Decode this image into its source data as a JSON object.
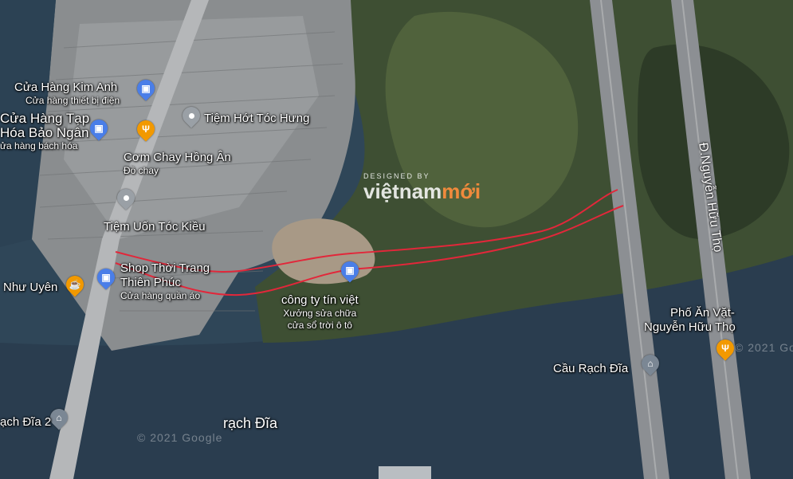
{
  "map": {
    "colors": {
      "water": "#2f4658",
      "river": "#2a3e50",
      "land_dark": "#2d3a2a",
      "land_green": "#4c5e3b",
      "urban": "#8f9295",
      "route": "#e2273a",
      "bridge": "#8c8f93"
    },
    "watermark": {
      "top": "DESIGNED BY",
      "main": "việtnam",
      "accent": "mới"
    },
    "road_labels": {
      "nguyen_huu_tho": "Đ.Nguyễn Hữu Thọ"
    },
    "water_labels": {
      "rach_dia": "rạch Đĩa"
    },
    "copyright": {
      "left": "© 2021 Google",
      "right": "© 2021 Goog"
    },
    "pois": [
      {
        "id": "kim-anh",
        "name": "Cửa Hàng Kim Anh",
        "sub": "Cửa hàng thiết bị điện",
        "icon": "shopping-bag-icon"
      },
      {
        "id": "tap-hoa",
        "name": "Cửa Hàng Tạp Hóa Bảo Ngân",
        "name_line1": "Cửa Hàng Tạp",
        "name_line2": "Hóa Bảo Ngân",
        "sub": "ửa hàng bách hóa",
        "icon": "shopping-bag-icon"
      },
      {
        "id": "toc-hung",
        "name": "Tiệm Hớt Tóc Hưng",
        "sub": "",
        "icon": "pin-icon"
      },
      {
        "id": "com-chay",
        "name": "Cơm Chay Hồng Ân",
        "sub": "Đồ chay",
        "icon": "fork-knife-icon"
      },
      {
        "id": "toc-kieu",
        "name": "Tiệm Uốn Tóc Kiều",
        "sub": "",
        "icon": "pin-icon"
      },
      {
        "id": "thoi-trang",
        "name_line1": "Shop Thời Trang",
        "name_line2": "Thiên Phúc",
        "sub": "Cửa hàng quần áo",
        "icon": "shopping-bag-icon"
      },
      {
        "id": "nhu-uyen",
        "name": "Như Uyên",
        "sub": "",
        "icon": "coffee-cup-icon"
      },
      {
        "id": "tin-viet",
        "name": "công ty tín việt",
        "sub_line1": "Xưởng sửa chữa",
        "sub_line2": "cửa sổ trời ô tô",
        "icon": "shopping-bag-icon"
      },
      {
        "id": "an-vat",
        "name_line1": "Phố Ăn Vặt-",
        "name_line2": "Nguyễn Hữu Thọ",
        "sub": "",
        "icon": "fork-knife-icon"
      },
      {
        "id": "cau-rach-dia",
        "name": "Cầu Rạch Đĩa",
        "sub": "",
        "icon": "bridge-icon"
      },
      {
        "id": "rach-dia-2",
        "name": "ạch Đĩa 2",
        "sub": "",
        "icon": "bridge-icon"
      }
    ]
  }
}
